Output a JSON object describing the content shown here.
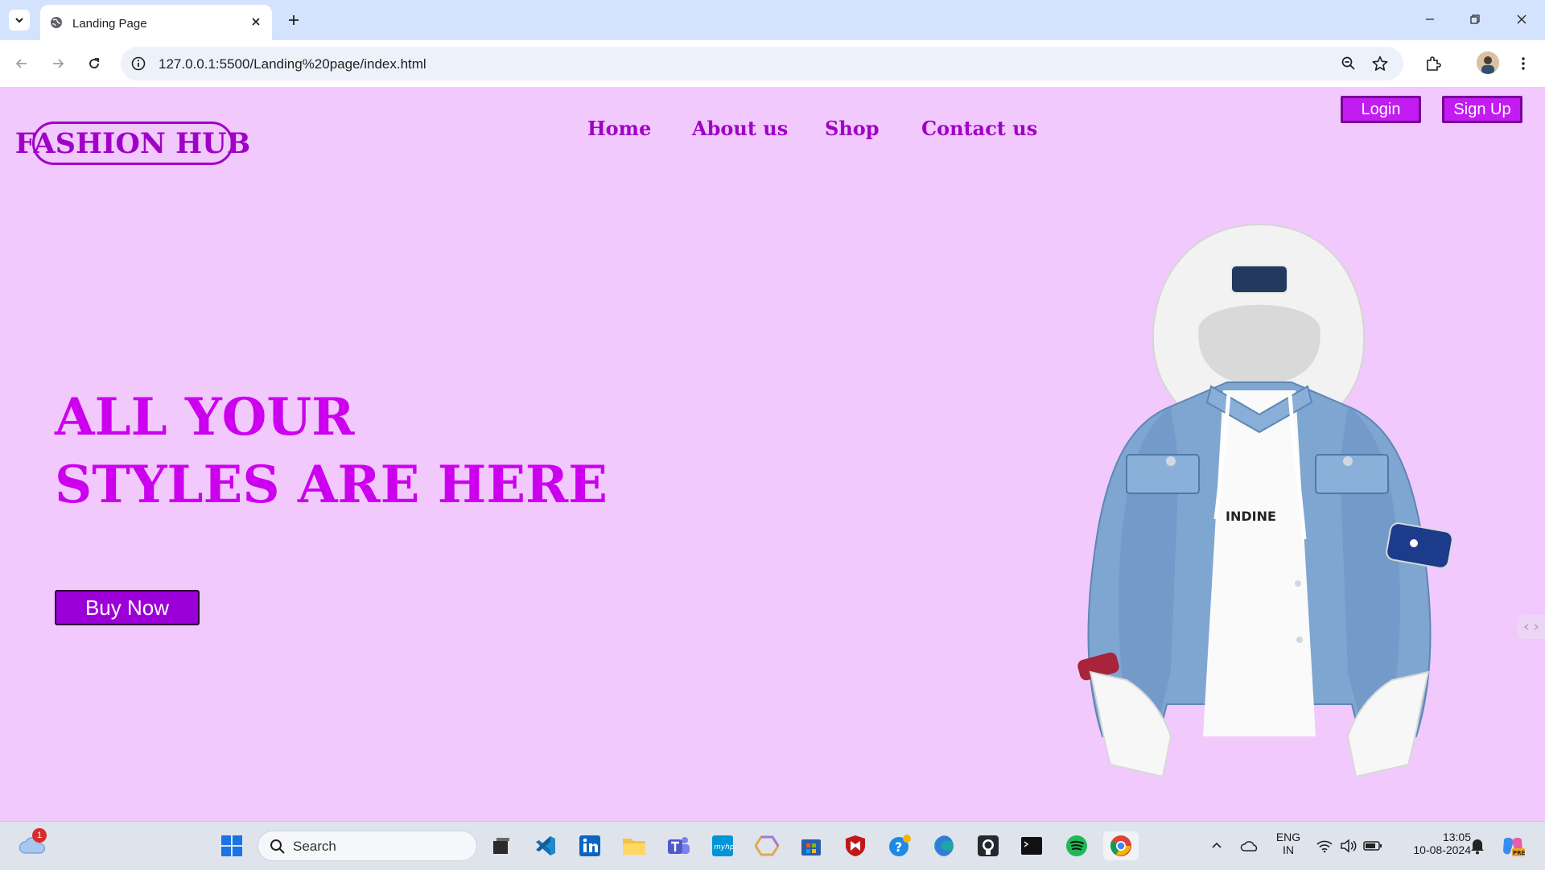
{
  "browser": {
    "tab_title": "Landing Page",
    "url": "127.0.0.1:5500/Landing%20page/index.html"
  },
  "site": {
    "logo": "FASHION HUB",
    "nav": [
      "Home",
      "About us",
      "Shop",
      "Contact us"
    ],
    "login_label": "Login",
    "signup_label": "Sign Up",
    "hero_line1": "ALL YOUR",
    "hero_line2": "STYLES ARE HERE",
    "cta_label": "Buy Now",
    "product_text": "INDINE",
    "accent_color": "#a000c8",
    "background_color": "#f1c9fc"
  },
  "taskbar": {
    "search_placeholder": "Search",
    "weather_badge": "1",
    "language": "ENG",
    "region": "IN",
    "time": "13:05",
    "date": "10-08-2024",
    "copilot_badge": "PRE"
  }
}
